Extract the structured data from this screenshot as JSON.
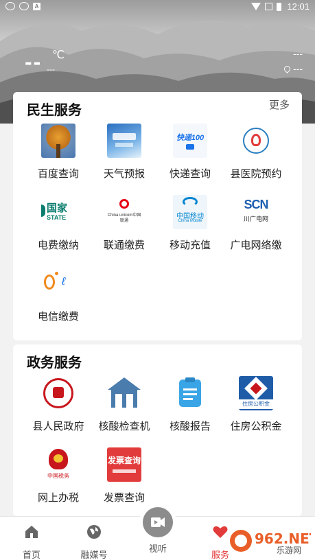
{
  "status_bar": {
    "time": "12:01",
    "left_badge": "A"
  },
  "weather": {
    "temperature": "--",
    "unit": "℃",
    "sub": "---",
    "right_top": "---",
    "location": "---"
  },
  "section_livelihood": {
    "title": "民生服务",
    "more_label": "更多",
    "items": [
      {
        "label": "百度查询",
        "icon": "tree-photo-icon"
      },
      {
        "label": "天气预报",
        "icon": "weather-forecast-icon"
      },
      {
        "label": "快递查询",
        "icon": "express-100-icon",
        "icon_text": "快递100"
      },
      {
        "label": "县医院预约",
        "icon": "hospital-logo-icon"
      },
      {
        "label": "电费缴纳",
        "icon": "state-grid-icon",
        "icon_text": "国家",
        "icon_text2": "STATE"
      },
      {
        "label": "联通缴费",
        "icon": "china-unicom-icon",
        "icon_text": "China unicom中国联通"
      },
      {
        "label": "移动充值",
        "icon": "china-mobile-icon",
        "icon_text": "中国移动",
        "icon_text2": "China Mobile"
      },
      {
        "label": "广电网络缴",
        "icon": "scn-cable-icon",
        "icon_text": "SCN",
        "icon_text2": "川广电网"
      },
      {
        "label": "电信缴费",
        "icon": "china-telecom-icon"
      }
    ]
  },
  "section_government": {
    "title": "政务服务",
    "items": [
      {
        "label": "县人民政府",
        "icon": "government-emblem-icon"
      },
      {
        "label": "核酸检查机",
        "icon": "house-icon"
      },
      {
        "label": "核酸报告",
        "icon": "clipboard-icon"
      },
      {
        "label": "住房公积金",
        "icon": "housing-fund-icon",
        "icon_text": "住房公积金"
      },
      {
        "label": "网上办税",
        "icon": "tax-emblem-icon",
        "icon_text": "中国税务"
      },
      {
        "label": "发票查询",
        "icon": "invoice-query-icon",
        "icon_text": "发票查询"
      }
    ]
  },
  "bottom_nav": {
    "items": [
      {
        "label": "首页",
        "icon": "home-icon"
      },
      {
        "label": "融媒号",
        "icon": "globe-icon"
      },
      {
        "label": "视听",
        "icon": "video-camera-icon"
      },
      {
        "label": "服务",
        "icon": "heart-icon"
      }
    ]
  },
  "watermark": {
    "text": "962.NET",
    "sub": "乐游网"
  },
  "colors": {
    "accent_red": "#e23b3b",
    "nav_gray": "#555555"
  }
}
